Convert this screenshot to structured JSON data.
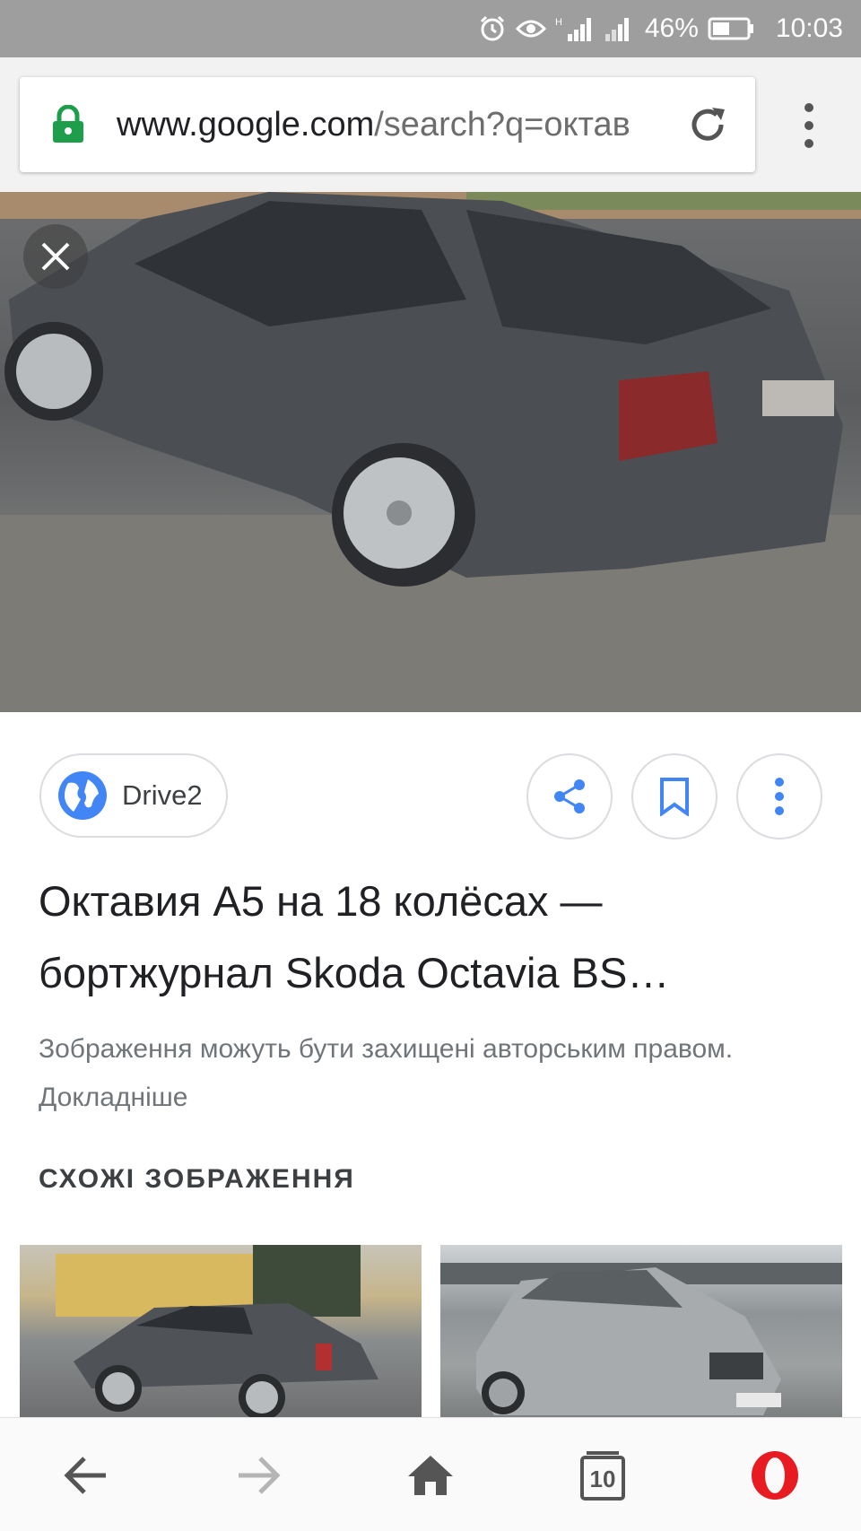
{
  "status_bar": {
    "battery_percent": "46%",
    "time": "10:03",
    "icons": [
      "alarm-icon",
      "eye-icon",
      "signal-h-icon",
      "signal-icon",
      "battery-icon"
    ]
  },
  "browser": {
    "url_host": "www.google.com",
    "url_path": "/search?q=октав",
    "icons": [
      "lock-icon",
      "reload-icon",
      "overflow-menu-icon"
    ]
  },
  "image_viewer": {
    "source_label": "Drive2",
    "title": "Октавия А5 на 18 колёсах — бортжурнал Skoda Octavia BS…",
    "copyright_note": "Зображення можуть бути захищені авторським правом. Докладніше",
    "related_heading": "СХОЖІ ЗОБРАЖЕННЯ",
    "action_icons": [
      "share-icon",
      "bookmark-icon",
      "more-vert-icon"
    ],
    "colors": {
      "accent": "#4285f4",
      "text": "#202124",
      "muted": "#70757a"
    }
  },
  "bottom_nav": {
    "tab_count": "10",
    "icons": [
      "back-arrow-icon",
      "forward-arrow-icon",
      "home-icon",
      "tabs-icon",
      "opera-logo-icon"
    ]
  }
}
